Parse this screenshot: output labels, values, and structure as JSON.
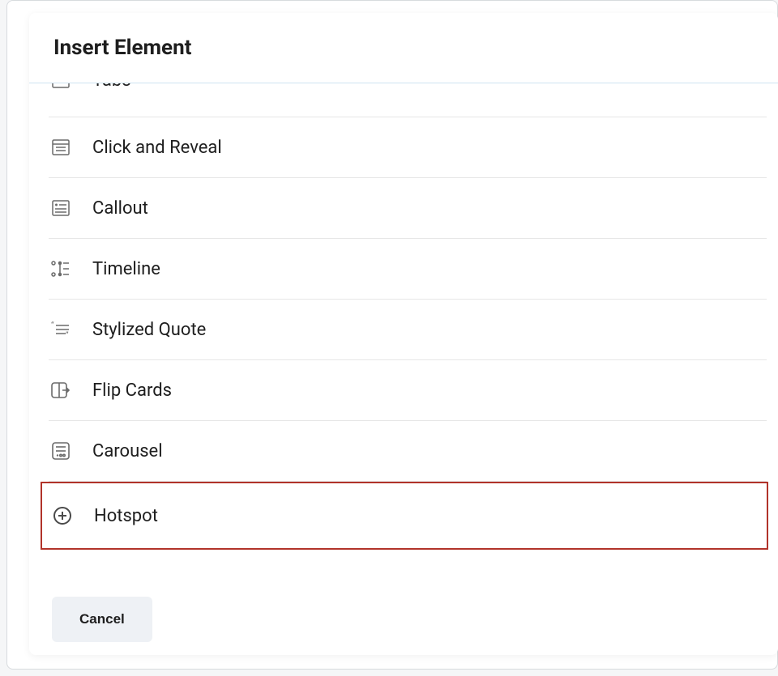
{
  "modal": {
    "title": "Insert Element",
    "footer": {
      "cancel_label": "Cancel"
    }
  },
  "elements": [
    {
      "icon": "tabs-icon",
      "label": "Tabs",
      "cutoff": true
    },
    {
      "icon": "click-reveal-icon",
      "label": "Click and Reveal"
    },
    {
      "icon": "callout-icon",
      "label": "Callout"
    },
    {
      "icon": "timeline-icon",
      "label": "Timeline"
    },
    {
      "icon": "stylized-quote-icon",
      "label": "Stylized Quote"
    },
    {
      "icon": "flip-cards-icon",
      "label": "Flip Cards"
    },
    {
      "icon": "carousel-icon",
      "label": "Carousel"
    },
    {
      "icon": "hotspot-icon",
      "label": "Hotspot",
      "highlighted": true
    }
  ]
}
